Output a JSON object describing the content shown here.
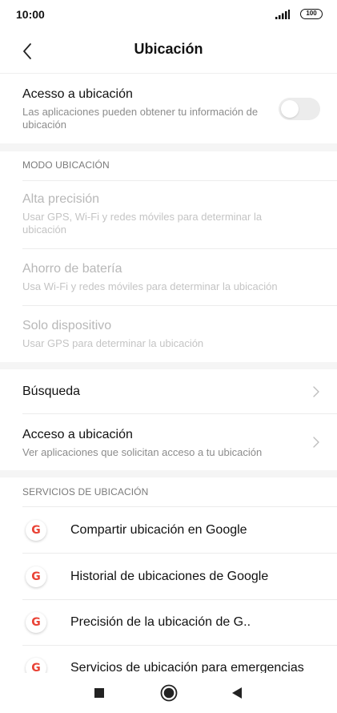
{
  "status": {
    "time": "10:00",
    "battery": "100"
  },
  "header": {
    "title": "Ubicación",
    "back_icon": "chevron-left-icon"
  },
  "location_access": {
    "title": "Acesso a ubicación",
    "subtitle": "Las aplicaciones pueden obtener tu información de ubicación",
    "enabled": false
  },
  "mode_section": {
    "label": "MODO UBICACIÓN",
    "items": [
      {
        "title": "Alta precisión",
        "subtitle": "Usar GPS, Wi-Fi y redes móviles para determinar la ubicación"
      },
      {
        "title": "Ahorro de batería",
        "subtitle": "Usa Wi-Fi y redes móviles para determinar la ubicación"
      },
      {
        "title": "Solo dispositivo",
        "subtitle": "Usar GPS para determinar la ubicación"
      }
    ]
  },
  "settings": {
    "search": {
      "title": "Búsqueda"
    },
    "app_access": {
      "title": "Acceso a ubicación",
      "subtitle": "Ver aplicaciones que solicitan acceso a tu ubicación"
    }
  },
  "services_section": {
    "label": "SERVICIOS DE UBICACIÓN",
    "icon": "google-icon",
    "icon_letter": "G",
    "items": [
      {
        "title": "Compartir ubicación en Google"
      },
      {
        "title": "Historial de ubicaciones de Google"
      },
      {
        "title": "Precisión de la ubicación de G.."
      },
      {
        "title": "Servicios de ubicación para emergencias"
      }
    ]
  },
  "navbar": {
    "icons": [
      "recents-square-icon",
      "home-circle-icon",
      "back-triangle-icon"
    ]
  },
  "colors": {
    "disabled_text": "#b8b8b8",
    "toggle_off": "#ececec",
    "google_red": "#e94235"
  }
}
